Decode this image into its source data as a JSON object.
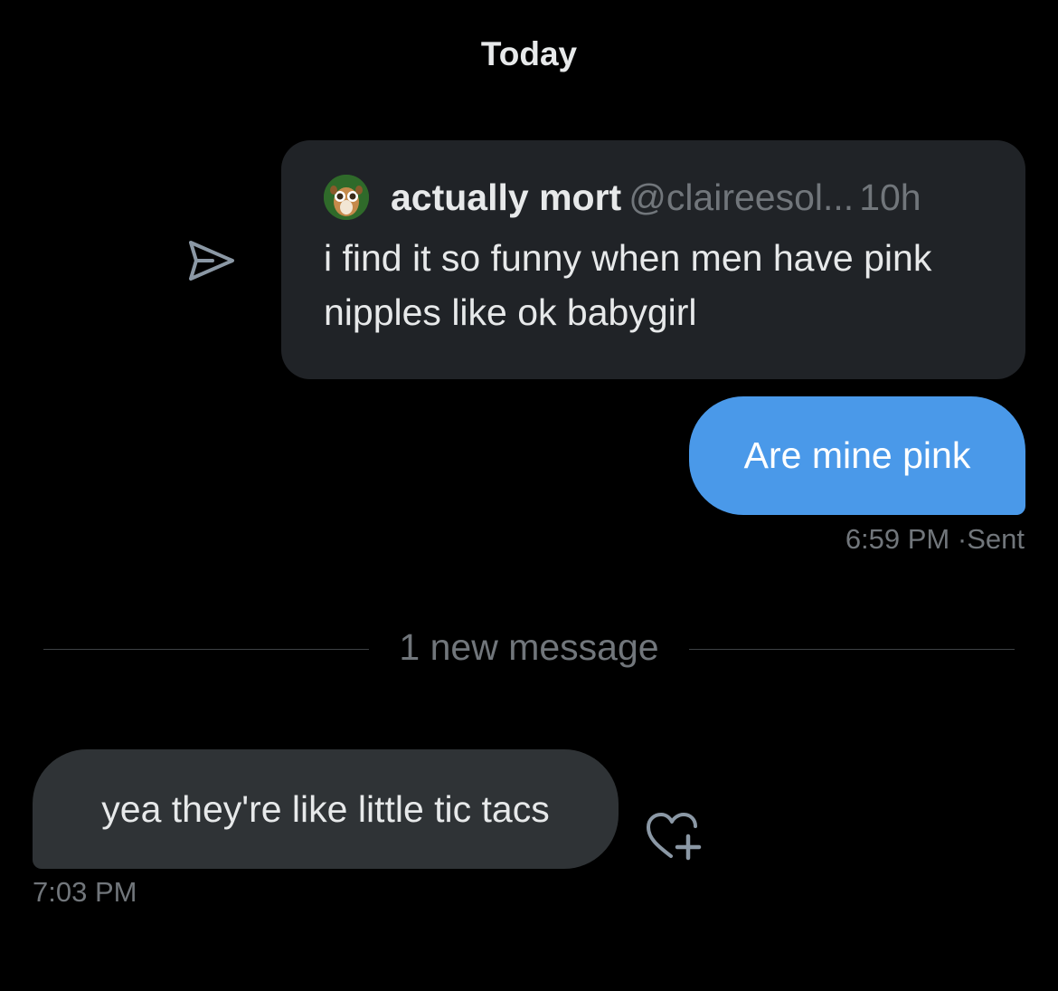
{
  "date_header": "Today",
  "quoted_tweet": {
    "display_name": "actually mort",
    "handle": "@claireesol...",
    "time": "10h",
    "text": "i find it so funny when men have pink nipples like ok babygirl",
    "avatar_icon": "lemur-avatar-icon"
  },
  "sent_message": {
    "text": "Are mine pink",
    "time": "6:59 PM",
    "separator": "·",
    "status": "Sent",
    "bubble_color": "#4a99e9"
  },
  "new_message_divider": "1 new message",
  "received_message": {
    "text": "yea they're like little tic tacs",
    "time": "7:03 PM",
    "bubble_color": "#2f3336"
  },
  "icons": {
    "share": "share-icon",
    "react": "add-reaction-heart-icon"
  },
  "colors": {
    "background": "#000000",
    "primary_text": "#e7e9ea",
    "secondary_text": "#71767b",
    "card": "#202327"
  }
}
